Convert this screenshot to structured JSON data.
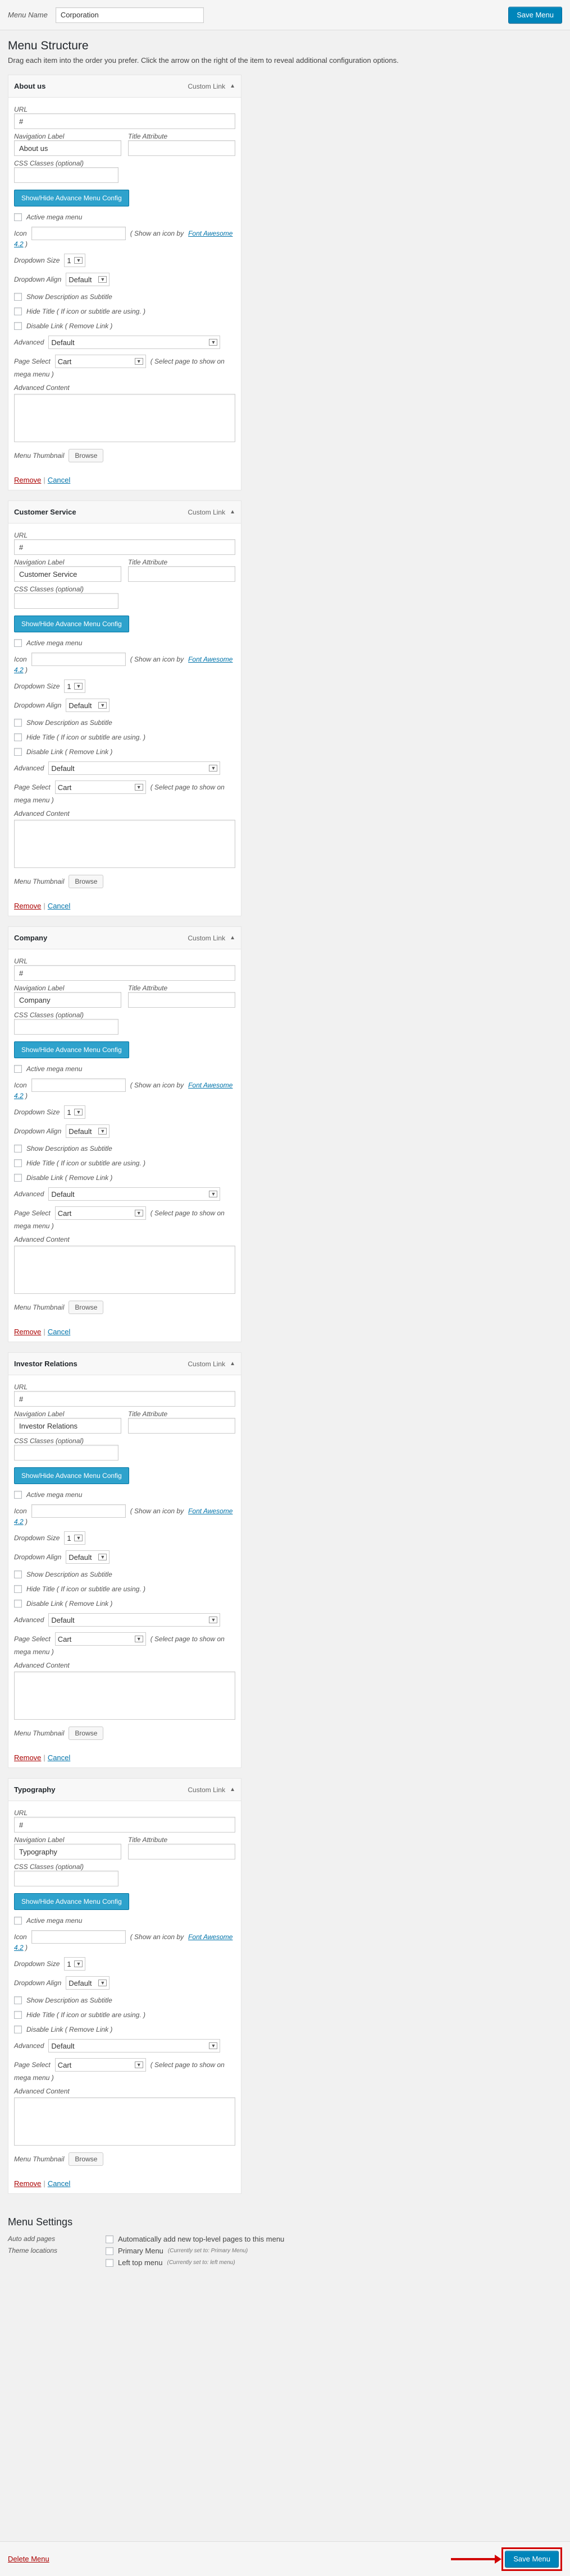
{
  "header": {
    "menu_name_label": "Menu Name",
    "menu_name_value": "Corporation",
    "save_label": "Save Menu"
  },
  "structure": {
    "title": "Menu Structure",
    "instructions": "Drag each item into the order you prefer. Click the arrow on the right of the item to reveal additional configuration options."
  },
  "labels": {
    "custom_link": "Custom Link",
    "url": "URL",
    "nav_label": "Navigation Label",
    "title_attr": "Title Attribute",
    "css_classes": "CSS Classes (optional)",
    "toggle_config": "Show/Hide Advance Menu Config",
    "mega_menu": "Active mega menu",
    "icon": "Icon",
    "icon_note": "( Show an icon by",
    "font_awesome": "Font Awesome",
    "fa_version": "4.2",
    "fa_close": ")",
    "dropdown_size": "Dropdown Size",
    "dropdown_size_value": "1",
    "dropdown_align": "Dropdown Align",
    "dropdown_align_value": "Default",
    "show_desc": "Show Description as Subtitle",
    "hide_title": "Hide Title ( If icon or subtitle are using. )",
    "disable_link": "Disable Link ( Remove Link )",
    "advanced": "Advanced",
    "advanced_value": "Default",
    "page_select": "Page Select",
    "page_select_value": "Cart",
    "page_select_note": "( Select page to show on",
    "page_select_note2": "mega menu )",
    "advanced_content": "Advanced Content",
    "thumbnail": "Menu Thumbnail",
    "browse": "Browse",
    "remove": "Remove",
    "sep": "|",
    "cancel": "Cancel"
  },
  "items": [
    {
      "title": "About us",
      "url": "#",
      "nav_label": "About us"
    },
    {
      "title": "Customer Service",
      "url": "#",
      "nav_label": "Customer Service"
    },
    {
      "title": "Company",
      "url": "#",
      "nav_label": "Company"
    },
    {
      "title": "Investor Relations",
      "url": "#",
      "nav_label": "Investor Relations"
    },
    {
      "title": "Typography",
      "url": "#",
      "nav_label": "Typography"
    }
  ],
  "settings": {
    "title": "Menu Settings",
    "auto_add_label": "Auto add pages",
    "auto_add_option": "Automatically add new top-level pages to this menu",
    "locations_label": "Theme locations",
    "primary_menu": "Primary Menu",
    "primary_note": "(Currently set to: Primary Menu)",
    "top_menu": "Left top menu",
    "top_note": "(Currently set to: left menu)"
  },
  "footer": {
    "delete_label": "Delete Menu",
    "save_label": "Save Menu"
  },
  "colors": {
    "primary": "#0085ba",
    "config_button": "#2ea2cc",
    "danger": "#a00000",
    "highlight": "#d10000"
  }
}
